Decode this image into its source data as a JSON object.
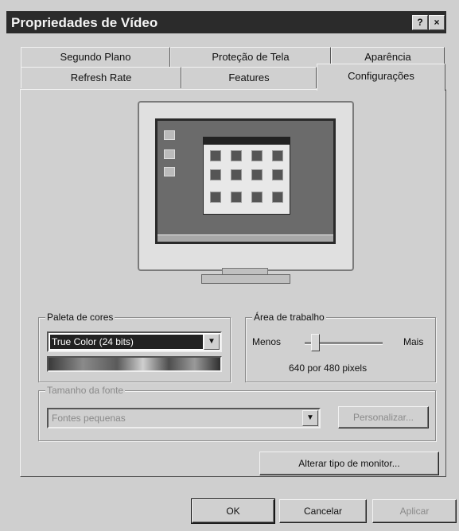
{
  "window": {
    "title": "Propriedades de Vídeo",
    "help_button": "?",
    "close_button": "×"
  },
  "tabs": {
    "row1": [
      "Segundo Plano",
      "Proteção de Tela",
      "Aparência"
    ],
    "row2": [
      "Refresh Rate",
      "Features",
      "Configurações"
    ],
    "active": "Configurações"
  },
  "color_palette": {
    "label": "Paleta de cores",
    "selected": "True Color (24 bits)"
  },
  "desktop_area": {
    "label": "Área de trabalho",
    "less": "Menos",
    "more": "Mais",
    "value": "640 por 480 pixels",
    "slider_position": 0.12
  },
  "font_size": {
    "label": "Tamanho da fonte",
    "selected": "Fontes pequenas",
    "customize_button": "Personalizar..."
  },
  "change_monitor_button": "Alterar tipo de monitor...",
  "footer": {
    "ok": "OK",
    "cancel": "Cancelar",
    "apply": "Aplicar"
  }
}
